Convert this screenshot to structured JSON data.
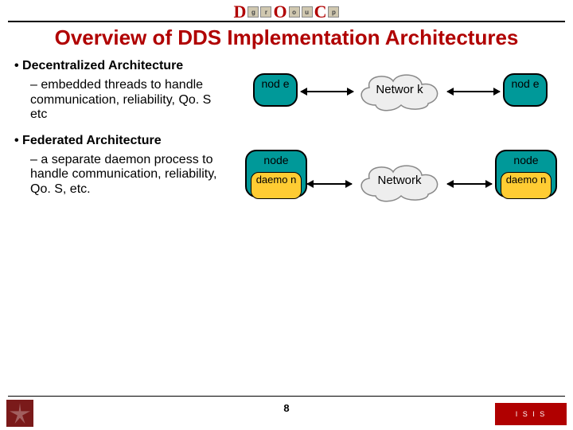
{
  "header": {
    "doc_letters": [
      "D",
      "O",
      "C"
    ],
    "doc_sub": [
      "g",
      "r",
      "o",
      "u",
      "p"
    ]
  },
  "title": "Overview of DDS Implementation Architectures",
  "page_number": "8",
  "bullets": {
    "b1": "Decentralized Architecture",
    "b1s": "embedded threads to handle communication, reliability, Qo. S etc",
    "b2": "Federated Architecture",
    "b2s": "a separate daemon process to handle communication, reliability, Qo. S, etc."
  },
  "diagram": {
    "row1": {
      "left_node": "nod e",
      "cloud": "Networ k",
      "right_node": "nod e"
    },
    "row2": {
      "left_node": "node",
      "left_daemon": "daemo n",
      "cloud": "Network",
      "right_node": "node",
      "right_daemon": "daemo n"
    }
  },
  "logos": {
    "right_text": "I S I S"
  }
}
